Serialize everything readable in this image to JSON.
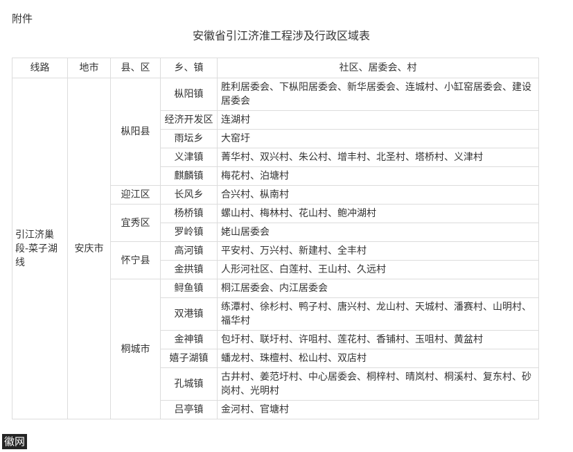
{
  "attachment_label": "附件",
  "title": "安徽省引江济淮工程涉及行政区域表",
  "headers": [
    "线路",
    "地市",
    "县、区",
    "乡、镇",
    "社区、居委会、村"
  ],
  "route": "引江济巢段-菜子湖线",
  "city": "安庆市",
  "counties": [
    "枞阳县",
    "迎江区",
    "宜秀区",
    "怀宁县",
    "桐城市"
  ],
  "rows": [
    {
      "town": "枞阳镇",
      "villages": "胜利居委会、下枞阳居委会、新华居委会、连城村、小缸窑居委会、建设居委会"
    },
    {
      "town": "经济开发区",
      "villages": "连湖村"
    },
    {
      "town": "雨坛乡",
      "villages": "大窑圩"
    },
    {
      "town": "义津镇",
      "villages": "菁华村、双兴村、朱公村、增丰村、北圣村、塔桥村、义津村"
    },
    {
      "town": "麒麟镇",
      "villages": "梅花村、泊塘村"
    },
    {
      "town": "长风乡",
      "villages": "合兴村、枞南村"
    },
    {
      "town": "杨桥镇",
      "villages": "螺山村、梅林村、花山村、鲍冲湖村"
    },
    {
      "town": "罗岭镇",
      "villages": "姥山居委会"
    },
    {
      "town": "高河镇",
      "villages": "平安村、万兴村、新建村、全丰村"
    },
    {
      "town": "金拱镇",
      "villages": "人形河社区、白莲村、王山村、久远村"
    },
    {
      "town": "鲟鱼镇",
      "villages": "桐江居委会、内江居委会"
    },
    {
      "town": "双港镇",
      "villages": "练潭村、徐杉村、鸭子村、唐兴村、龙山村、天城村、潘赛村、山明村、福华村"
    },
    {
      "town": "金神镇",
      "villages": "包圩村、联圩村、许咀村、莲花村、香铺村、玉咀村、黄盆村"
    },
    {
      "town": "嬉子湖镇",
      "villages": "蟠龙村、珠檀村、松山村、双店村"
    },
    {
      "town": "孔城镇",
      "villages": "古井村、姜范圩村、中心居委会、桐梓村、晴岚村、桐溪村、复东村、砂岗村、光明村"
    },
    {
      "town": "吕亭镇",
      "villages": "金河村、官塘村"
    }
  ],
  "watermark": "徽网"
}
